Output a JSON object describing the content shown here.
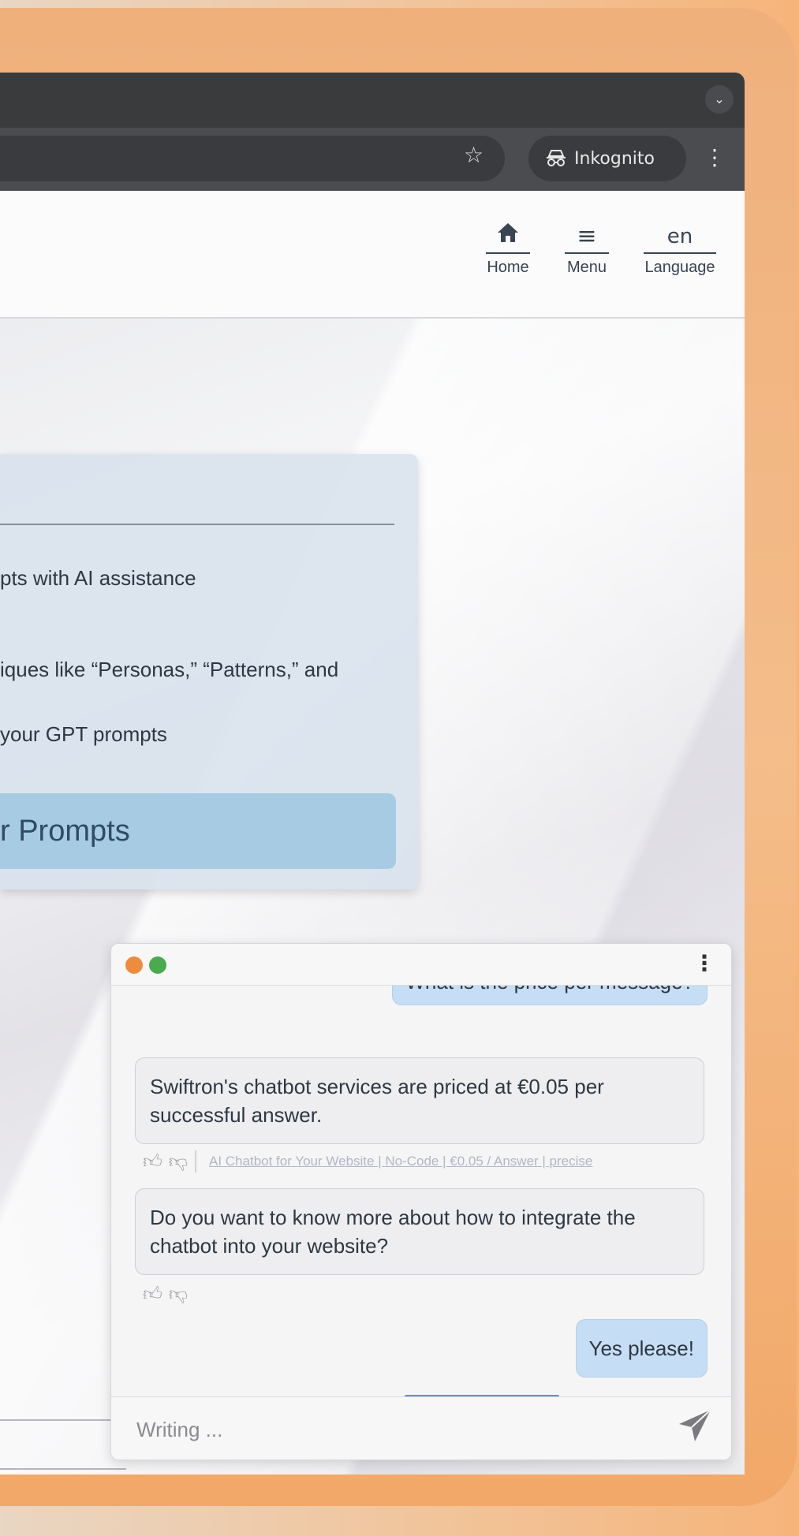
{
  "browser": {
    "incognito_label": "Inkognito",
    "icons": [
      "tab-dropdown-icon",
      "star-icon",
      "incognito-icon",
      "kebab-icon"
    ]
  },
  "nav": {
    "home_label": "Home",
    "menu_label": "Menu",
    "language_code": "en",
    "language_label": "Language"
  },
  "card": {
    "line1": "pts with AI assistance",
    "line2": "iques like “Personas,” “Patterns,” and",
    "line3": "your GPT prompts",
    "button_label": "r Prompts"
  },
  "chat": {
    "messages": [
      {
        "role": "user",
        "text": "What is the price per message?"
      },
      {
        "role": "bot",
        "text": "Swiftron's chatbot services are priced at €0.05 per successful answer."
      },
      {
        "role": "bot",
        "text": "Do you want to know more about how to integrate the chatbot into your website?"
      },
      {
        "role": "user",
        "text": "Yes please!"
      }
    ],
    "source_link": "AI Chatbot for Your Website | No-Code | €0.05 / Answer | precise",
    "input_placeholder": "Writing ...",
    "colors": {
      "dot_orange": "#ee8c3d",
      "dot_green": "#4aaa4e",
      "user_bubble": "#c6def5"
    }
  }
}
